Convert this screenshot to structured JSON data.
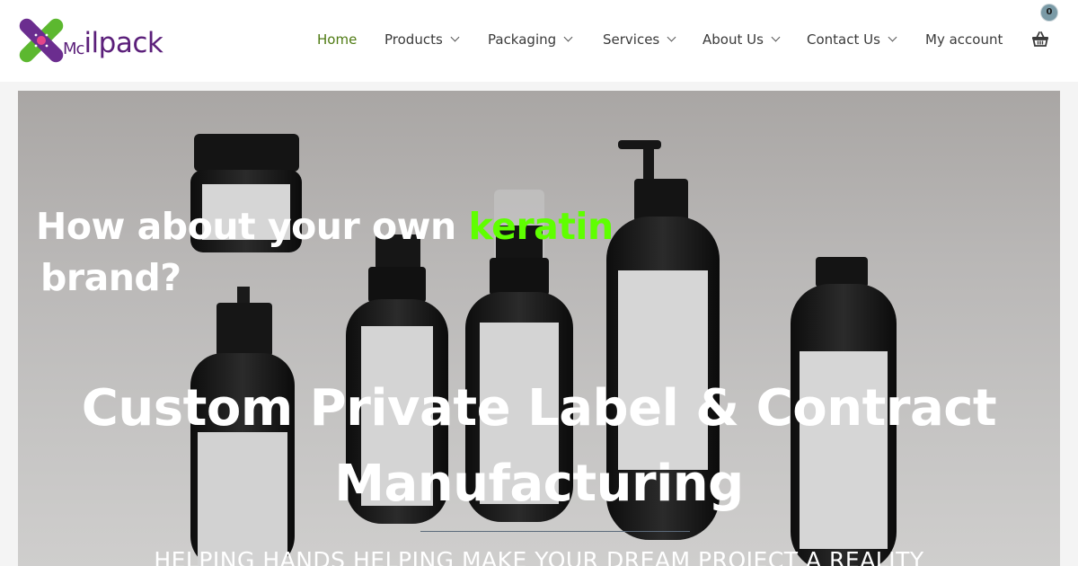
{
  "brand": {
    "logo_prefix": "Mc",
    "logo_name": "ilpack",
    "colors": {
      "purple": "#5b1f7a",
      "green": "#5cb82f",
      "accent_green": "#5fff00"
    }
  },
  "nav": {
    "items": [
      {
        "label": "Home",
        "active": true,
        "dropdown": false
      },
      {
        "label": "Products",
        "active": false,
        "dropdown": true
      },
      {
        "label": "Packaging",
        "active": false,
        "dropdown": true
      },
      {
        "label": "Services",
        "active": false,
        "dropdown": true
      },
      {
        "label": "About Us",
        "active": false,
        "dropdown": true
      },
      {
        "label": "Contact Us",
        "active": false,
        "dropdown": true
      },
      {
        "label": "My account",
        "active": false,
        "dropdown": false
      }
    ],
    "cart_icon": "basket-icon",
    "cart_count": "0"
  },
  "hero": {
    "question_part1": "How about your own ",
    "question_highlight": "keratin",
    "question_part2": "brand?",
    "title_line1": "Custom Private Label & Contract",
    "title_line2": "Manufacturing",
    "subtitle": "HELPING HANDS HELPING MAKE YOUR DREAM PROJECT A REALITY"
  }
}
